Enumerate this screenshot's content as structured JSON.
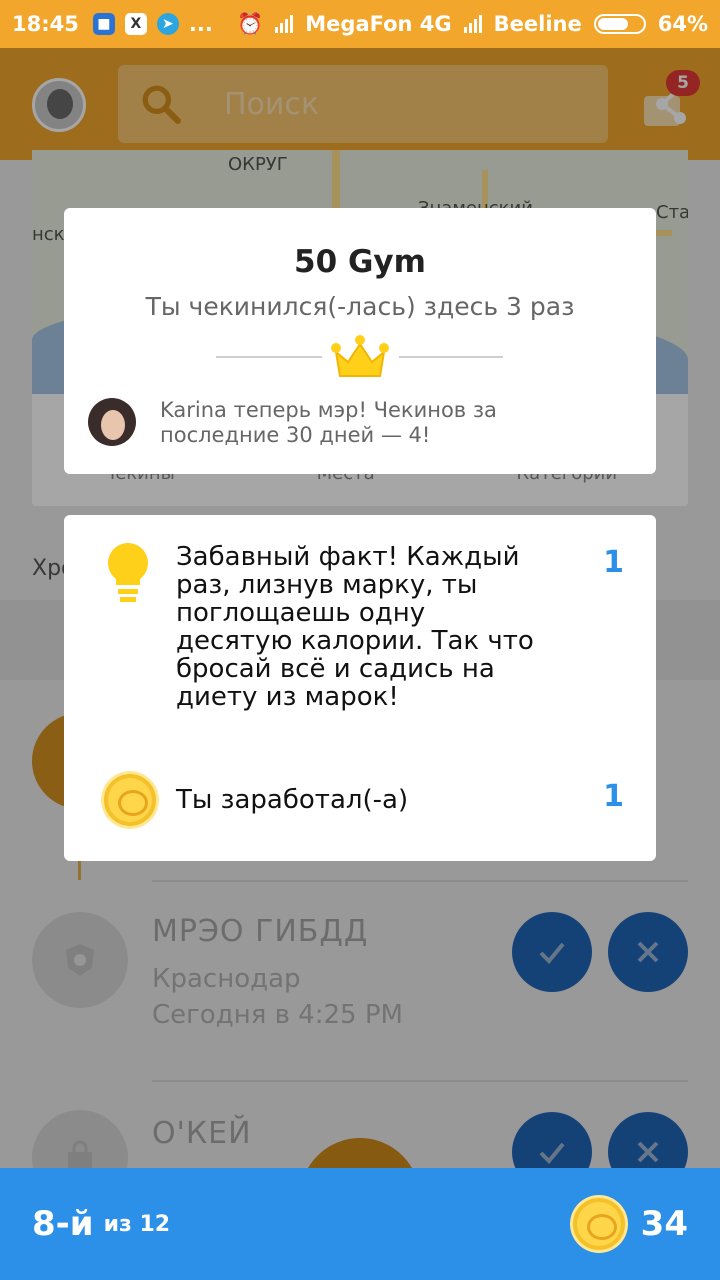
{
  "status_bar": {
    "time": "18:45",
    "ellipsis": "...",
    "carrier1": "MegaFon 4G",
    "carrier2": "Beeline",
    "battery": "64%"
  },
  "app_bar": {
    "search_placeholder": "Поиск",
    "share_badge": "5"
  },
  "map": {
    "labels": [
      "ОКРУГ",
      "Знаменский",
      "нск",
      "Ста"
    ],
    "tabs": [
      "Чекины",
      "Места",
      "Категории"
    ]
  },
  "history_label": "Хронология",
  "timeline": [
    {
      "name": "МРЭО ГИБДД",
      "city": "Краснодар",
      "time": "Сегодня в 4:25 PM"
    },
    {
      "name": "О'КЕЙ"
    }
  ],
  "bottom_bar": {
    "rank": "8-й",
    "rank_of": "из 12",
    "coins": "34"
  },
  "checkin_card": {
    "venue": "50 Gym",
    "visits": "Ты чекинился(-лась) здесь 3 раз",
    "mayor_text": "Karina теперь мэр! Чекинов за последние 30 дней — 4!"
  },
  "reward_card": {
    "fact": "Забавный факт! Каждый раз, лизнув марку, ты поглощаешь одну десятую калории. Так что бросай всё и садись на диету из марок!",
    "fact_count": "1",
    "earned_label": "Ты заработал(-а)",
    "earned_count": "1"
  },
  "colors": {
    "accent": "#f2a72c",
    "bottom_bar": "#2c8fe8",
    "action_button": "#1f66b5"
  }
}
